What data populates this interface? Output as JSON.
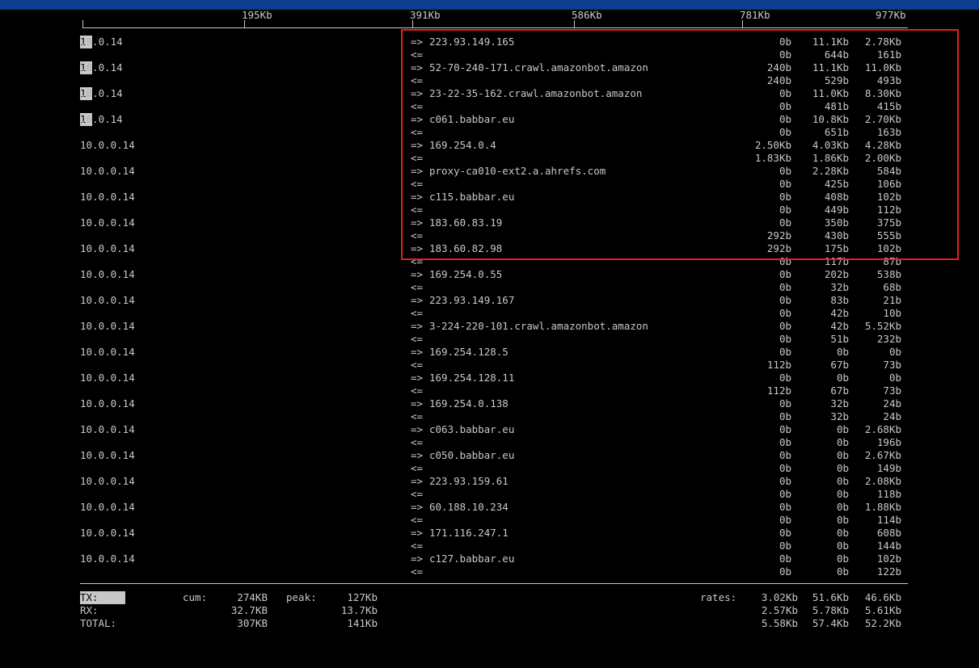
{
  "header": {
    "topbar_text": "",
    "scale_labels": [
      "195Kb",
      "391Kb",
      "586Kb",
      "781Kb",
      "977Kb"
    ]
  },
  "rows": [
    {
      "src": "10.0.0.14",
      "hl": true,
      "out": {
        "host": "223.93.149.165",
        "r": [
          "0b",
          "11.1Kb",
          "2.78Kb"
        ]
      },
      "in": {
        "r": [
          "0b",
          "644b",
          "161b"
        ]
      }
    },
    {
      "src": "10.0.0.14",
      "hl": true,
      "out": {
        "host": "52-70-240-171.crawl.amazonbot.amazon",
        "r": [
          "240b",
          "11.1Kb",
          "11.0Kb"
        ]
      },
      "in": {
        "r": [
          "240b",
          "529b",
          "493b"
        ]
      }
    },
    {
      "src": "10.0.0.14",
      "hl": true,
      "out": {
        "host": "23-22-35-162.crawl.amazonbot.amazon",
        "r": [
          "0b",
          "11.0Kb",
          "8.30Kb"
        ]
      },
      "in": {
        "r": [
          "0b",
          "481b",
          "415b"
        ]
      }
    },
    {
      "src": "10.0.0.14",
      "hl": true,
      "out": {
        "host": "c061.babbar.eu",
        "r": [
          "0b",
          "10.8Kb",
          "2.70Kb"
        ]
      },
      "in": {
        "r": [
          "0b",
          "651b",
          "163b"
        ]
      }
    },
    {
      "src": "10.0.0.14",
      "hl": false,
      "out": {
        "host": "169.254.0.4",
        "r": [
          "2.50Kb",
          "4.03Kb",
          "4.28Kb"
        ]
      },
      "in": {
        "r": [
          "1.83Kb",
          "1.86Kb",
          "2.00Kb"
        ]
      }
    },
    {
      "src": "10.0.0.14",
      "hl": false,
      "out": {
        "host": "proxy-ca010-ext2.a.ahrefs.com",
        "r": [
          "0b",
          "2.28Kb",
          "584b"
        ]
      },
      "in": {
        "r": [
          "0b",
          "425b",
          "106b"
        ]
      }
    },
    {
      "src": "10.0.0.14",
      "hl": false,
      "out": {
        "host": "c115.babbar.eu",
        "r": [
          "0b",
          "408b",
          "102b"
        ]
      },
      "in": {
        "r": [
          "0b",
          "449b",
          "112b"
        ]
      }
    },
    {
      "src": "10.0.0.14",
      "hl": false,
      "out": {
        "host": "183.60.83.19",
        "r": [
          "0b",
          "350b",
          "375b"
        ]
      },
      "in": {
        "r": [
          "292b",
          "430b",
          "555b"
        ]
      }
    },
    {
      "src": "10.0.0.14",
      "hl": false,
      "out": {
        "host": "183.60.82.98",
        "r": [
          "292b",
          "175b",
          "102b"
        ]
      },
      "in": {
        "r": [
          "0b",
          "117b",
          "87b"
        ]
      }
    },
    {
      "src": "10.0.0.14",
      "hl": false,
      "out": {
        "host": "169.254.0.55",
        "r": [
          "0b",
          "202b",
          "538b"
        ]
      },
      "in": {
        "r": [
          "0b",
          "32b",
          "68b"
        ]
      }
    },
    {
      "src": "10.0.0.14",
      "hl": false,
      "out": {
        "host": "223.93.149.167",
        "r": [
          "0b",
          "83b",
          "21b"
        ]
      },
      "in": {
        "r": [
          "0b",
          "42b",
          "10b"
        ]
      }
    },
    {
      "src": "10.0.0.14",
      "hl": false,
      "out": {
        "host": "3-224-220-101.crawl.amazonbot.amazon",
        "r": [
          "0b",
          "42b",
          "5.52Kb"
        ]
      },
      "in": {
        "r": [
          "0b",
          "51b",
          "232b"
        ]
      }
    },
    {
      "src": "10.0.0.14",
      "hl": false,
      "out": {
        "host": "169.254.128.5",
        "r": [
          "0b",
          "0b",
          "0b"
        ]
      },
      "in": {
        "r": [
          "112b",
          "67b",
          "73b"
        ]
      }
    },
    {
      "src": "10.0.0.14",
      "hl": false,
      "out": {
        "host": "169.254.128.11",
        "r": [
          "0b",
          "0b",
          "0b"
        ]
      },
      "in": {
        "r": [
          "112b",
          "67b",
          "73b"
        ]
      }
    },
    {
      "src": "10.0.0.14",
      "hl": false,
      "out": {
        "host": "169.254.0.138",
        "r": [
          "0b",
          "32b",
          "24b"
        ]
      },
      "in": {
        "r": [
          "0b",
          "32b",
          "24b"
        ]
      }
    },
    {
      "src": "10.0.0.14",
      "hl": false,
      "out": {
        "host": "c063.babbar.eu",
        "r": [
          "0b",
          "0b",
          "2.68Kb"
        ]
      },
      "in": {
        "r": [
          "0b",
          "0b",
          "196b"
        ]
      }
    },
    {
      "src": "10.0.0.14",
      "hl": false,
      "out": {
        "host": "c050.babbar.eu",
        "r": [
          "0b",
          "0b",
          "2.67Kb"
        ]
      },
      "in": {
        "r": [
          "0b",
          "0b",
          "149b"
        ]
      }
    },
    {
      "src": "10.0.0.14",
      "hl": false,
      "out": {
        "host": "223.93.159.61",
        "r": [
          "0b",
          "0b",
          "2.08Kb"
        ]
      },
      "in": {
        "r": [
          "0b",
          "0b",
          "118b"
        ]
      }
    },
    {
      "src": "10.0.0.14",
      "hl": false,
      "out": {
        "host": "60.188.10.234",
        "r": [
          "0b",
          "0b",
          "1.88Kb"
        ]
      },
      "in": {
        "r": [
          "0b",
          "0b",
          "114b"
        ]
      }
    },
    {
      "src": "10.0.0.14",
      "hl": false,
      "out": {
        "host": "171.116.247.1",
        "r": [
          "0b",
          "0b",
          "608b"
        ]
      },
      "in": {
        "r": [
          "0b",
          "0b",
          "144b"
        ]
      }
    },
    {
      "src": "10.0.0.14",
      "hl": false,
      "out": {
        "host": "c127.babbar.eu",
        "r": [
          "0b",
          "0b",
          "102b"
        ]
      },
      "in": {
        "r": [
          "0b",
          "0b",
          "122b"
        ]
      }
    }
  ],
  "arrows": {
    "out": "=>",
    "in": "<="
  },
  "footer": {
    "tx": {
      "label": "TX:",
      "cum": "274KB",
      "peak": "127Kb",
      "rates": [
        "3.02Kb",
        "51.6Kb",
        "46.6Kb"
      ]
    },
    "rx": {
      "label": "RX:",
      "cum": "32.7KB",
      "peak": "13.7Kb",
      "rates": [
        "2.57Kb",
        "5.78Kb",
        "5.61Kb"
      ]
    },
    "total": {
      "label": "TOTAL:",
      "cum": "307KB",
      "peak": "141Kb",
      "rates": [
        "5.58Kb",
        "57.4Kb",
        "52.2Kb"
      ]
    },
    "cum_label": "cum:",
    "peak_label": "peak:",
    "rates_label": "rates:"
  },
  "colors": {
    "background": "#000000",
    "text": "#c8c8c8",
    "topbar": "#0c3d8f",
    "highlight_box": "#e02020"
  }
}
